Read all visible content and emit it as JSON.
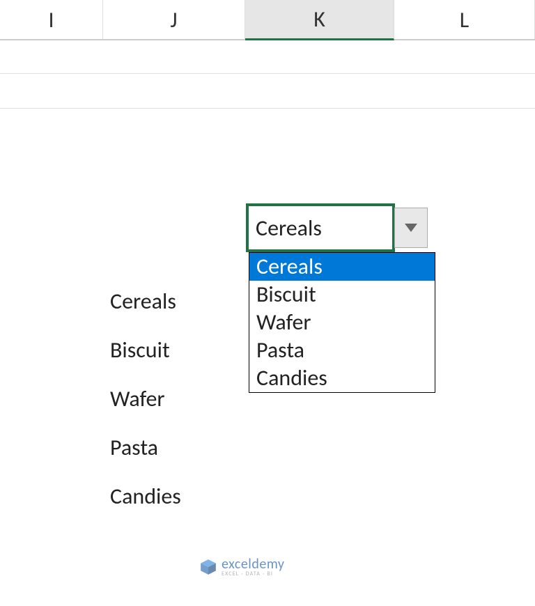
{
  "columns": {
    "i": "I",
    "j": "J",
    "k": "K",
    "l": "L"
  },
  "active_column": "K",
  "selected_cell_value": "Cereals",
  "dropdown": {
    "items": [
      "Cereals",
      "Biscuit",
      "Wafer",
      "Pasta",
      "Candies"
    ],
    "selected_index": 0
  },
  "list_column": {
    "items": [
      "Cereals",
      "Biscuit",
      "Wafer",
      "Pasta",
      "Candies"
    ]
  },
  "watermark": {
    "brand": "exceldemy",
    "tagline": "EXCEL · DATA · BI"
  },
  "colors": {
    "excel_green": "#217346",
    "selection_blue": "#0078d7",
    "header_active": "#e6e6e6"
  }
}
